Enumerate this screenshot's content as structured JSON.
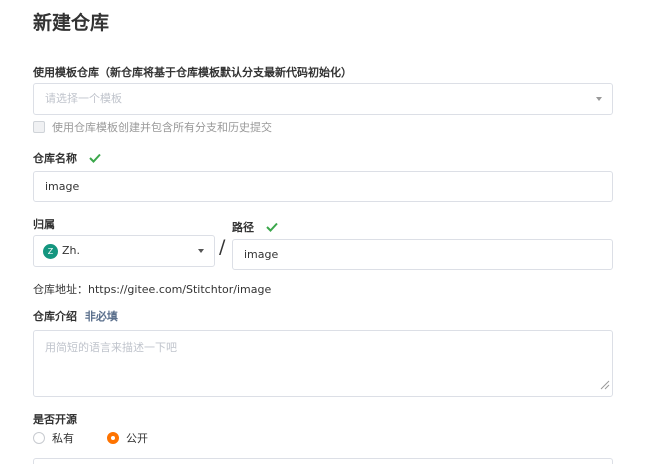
{
  "page_title": "新建仓库",
  "template": {
    "label": "使用模板仓库（新仓库将基于仓库模板默认分支最新代码初始化）",
    "placeholder": "请选择一个模板",
    "include_all_branches_label": "使用仓库模板创建并包含所有分支和历史提交"
  },
  "repo_name": {
    "label": "仓库名称",
    "value": "image"
  },
  "owner": {
    "label": "归属",
    "avatar_letter": "Z",
    "value": "Zh."
  },
  "separator": "/",
  "path": {
    "label": "路径",
    "value": "image"
  },
  "address": {
    "label": "仓库地址：",
    "url": "https://gitee.com/Stitchtor/image"
  },
  "description": {
    "label": "仓库介绍",
    "optional": "非必填",
    "placeholder": "用简短的语言来描述一下吧"
  },
  "open_source": {
    "label": "是否开源",
    "options": [
      {
        "label": "私有",
        "selected": false
      },
      {
        "label": "公开",
        "selected": true
      }
    ]
  },
  "colors": {
    "accent": "#fe7300",
    "success": "#3ba74b",
    "avatar_bg": "#14967f",
    "optional_text": "#5a6f8c"
  },
  "icons": {
    "valid": "check-icon",
    "dropdown": "caret-down-icon"
  }
}
